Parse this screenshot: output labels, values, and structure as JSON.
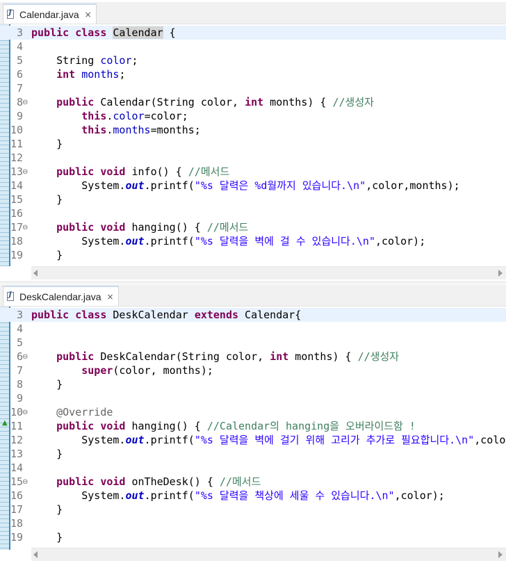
{
  "editors": [
    {
      "tab": {
        "title": "Calendar.java",
        "close": "×"
      },
      "lines": [
        {
          "n": "3",
          "fold": "",
          "cur": true,
          "tokens": [
            {
              "t": "public",
              "c": "kw"
            },
            {
              "t": " "
            },
            {
              "t": "class",
              "c": "kw"
            },
            {
              "t": " "
            },
            {
              "t": "Calendar",
              "c": "hl"
            },
            {
              "t": " {"
            }
          ]
        },
        {
          "n": "4",
          "tokens": []
        },
        {
          "n": "5",
          "tokens": [
            {
              "t": "    String "
            },
            {
              "t": "color",
              "c": "fld"
            },
            {
              "t": ";"
            }
          ]
        },
        {
          "n": "6",
          "tokens": [
            {
              "t": "    "
            },
            {
              "t": "int",
              "c": "kw"
            },
            {
              "t": " "
            },
            {
              "t": "months",
              "c": "fld"
            },
            {
              "t": ";"
            }
          ]
        },
        {
          "n": "7",
          "tokens": []
        },
        {
          "n": "8",
          "fold": "⊖",
          "tokens": [
            {
              "t": "    "
            },
            {
              "t": "public",
              "c": "kw"
            },
            {
              "t": " Calendar(String color, "
            },
            {
              "t": "int",
              "c": "kw"
            },
            {
              "t": " months) { "
            },
            {
              "t": "//생성자",
              "c": "cmt"
            }
          ]
        },
        {
          "n": "9",
          "tokens": [
            {
              "t": "        "
            },
            {
              "t": "this",
              "c": "kw"
            },
            {
              "t": "."
            },
            {
              "t": "color",
              "c": "fld"
            },
            {
              "t": "=color;"
            }
          ]
        },
        {
          "n": "10",
          "tokens": [
            {
              "t": "        "
            },
            {
              "t": "this",
              "c": "kw"
            },
            {
              "t": "."
            },
            {
              "t": "months",
              "c": "fld"
            },
            {
              "t": "=months;"
            }
          ]
        },
        {
          "n": "11",
          "tokens": [
            {
              "t": "    }"
            }
          ]
        },
        {
          "n": "12",
          "tokens": []
        },
        {
          "n": "13",
          "fold": "⊖",
          "tokens": [
            {
              "t": "    "
            },
            {
              "t": "public",
              "c": "kw"
            },
            {
              "t": " "
            },
            {
              "t": "void",
              "c": "kw"
            },
            {
              "t": " info() { "
            },
            {
              "t": "//메서드",
              "c": "cmt"
            }
          ]
        },
        {
          "n": "14",
          "tokens": [
            {
              "t": "        System."
            },
            {
              "t": "out",
              "c": "sfld"
            },
            {
              "t": ".printf("
            },
            {
              "t": "\"%s 달력은 %d월까지 있습니다.\\n\"",
              "c": "str"
            },
            {
              "t": ",color,months);"
            }
          ]
        },
        {
          "n": "15",
          "tokens": [
            {
              "t": "    }"
            }
          ]
        },
        {
          "n": "16",
          "tokens": []
        },
        {
          "n": "17",
          "fold": "⊖",
          "tokens": [
            {
              "t": "    "
            },
            {
              "t": "public",
              "c": "kw"
            },
            {
              "t": " "
            },
            {
              "t": "void",
              "c": "kw"
            },
            {
              "t": " hanging() { "
            },
            {
              "t": "//메서드",
              "c": "cmt"
            }
          ]
        },
        {
          "n": "18",
          "tokens": [
            {
              "t": "        System."
            },
            {
              "t": "out",
              "c": "sfld"
            },
            {
              "t": ".printf("
            },
            {
              "t": "\"%s 달력을 벽에 걸 수 있습니다.\\n\"",
              "c": "str"
            },
            {
              "t": ",color);"
            }
          ]
        },
        {
          "n": "19",
          "tokens": [
            {
              "t": "    }"
            }
          ]
        }
      ]
    },
    {
      "tab": {
        "title": "DeskCalendar.java",
        "close": "×"
      },
      "lines": [
        {
          "n": "3",
          "cur": true,
          "tokens": [
            {
              "t": "public",
              "c": "kw"
            },
            {
              "t": " "
            },
            {
              "t": "class",
              "c": "kw"
            },
            {
              "t": " DeskCalendar "
            },
            {
              "t": "extends",
              "c": "kw"
            },
            {
              "t": " Calendar{"
            }
          ]
        },
        {
          "n": "4",
          "tokens": []
        },
        {
          "n": "5",
          "tokens": []
        },
        {
          "n": "6",
          "fold": "⊖",
          "tokens": [
            {
              "t": "    "
            },
            {
              "t": "public",
              "c": "kw"
            },
            {
              "t": " DeskCalendar(String color, "
            },
            {
              "t": "int",
              "c": "kw"
            },
            {
              "t": " months) { "
            },
            {
              "t": "//생성자",
              "c": "cmt"
            }
          ]
        },
        {
          "n": "7",
          "tokens": [
            {
              "t": "        "
            },
            {
              "t": "super",
              "c": "kw"
            },
            {
              "t": "(color, months);"
            }
          ]
        },
        {
          "n": "8",
          "tokens": [
            {
              "t": "    }"
            }
          ]
        },
        {
          "n": "9",
          "tokens": []
        },
        {
          "n": "10",
          "fold": "⊖",
          "tokens": [
            {
              "t": "    "
            },
            {
              "t": "@Override",
              "c": "ann"
            }
          ]
        },
        {
          "n": "11",
          "override": "▲",
          "tokens": [
            {
              "t": "    "
            },
            {
              "t": "public",
              "c": "kw"
            },
            {
              "t": " "
            },
            {
              "t": "void",
              "c": "kw"
            },
            {
              "t": " hanging() { "
            },
            {
              "t": "//Calendar의 hanging을 오버라이드함 !",
              "c": "cmt"
            }
          ]
        },
        {
          "n": "12",
          "tokens": [
            {
              "t": "        System."
            },
            {
              "t": "out",
              "c": "sfld"
            },
            {
              "t": ".printf("
            },
            {
              "t": "\"%s 달력을 벽에 걸기 위해 고리가 추가로 필요합니다.\\n\"",
              "c": "str"
            },
            {
              "t": ",color);"
            }
          ]
        },
        {
          "n": "13",
          "tokens": [
            {
              "t": "    }"
            }
          ]
        },
        {
          "n": "14",
          "tokens": []
        },
        {
          "n": "15",
          "fold": "⊖",
          "tokens": [
            {
              "t": "    "
            },
            {
              "t": "public",
              "c": "kw"
            },
            {
              "t": " "
            },
            {
              "t": "void",
              "c": "kw"
            },
            {
              "t": " onTheDesk() { "
            },
            {
              "t": "//메서드",
              "c": "cmt"
            }
          ]
        },
        {
          "n": "16",
          "tokens": [
            {
              "t": "        System."
            },
            {
              "t": "out",
              "c": "sfld"
            },
            {
              "t": ".printf("
            },
            {
              "t": "\"%s 달력을 책상에 세울 수 있습니다.\\n\"",
              "c": "str"
            },
            {
              "t": ",color);"
            }
          ]
        },
        {
          "n": "17",
          "tokens": [
            {
              "t": "    }"
            }
          ]
        },
        {
          "n": "18",
          "tokens": []
        },
        {
          "n": "19",
          "tokens": [
            {
              "t": "    }"
            }
          ]
        }
      ]
    }
  ]
}
